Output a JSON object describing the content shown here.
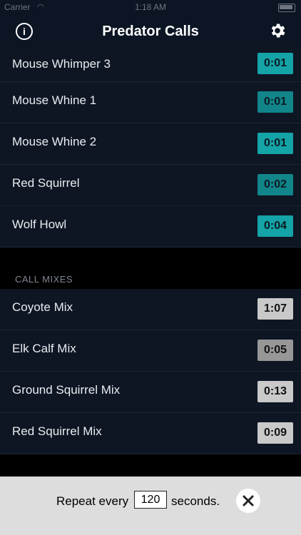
{
  "status": {
    "carrier": "Carrier",
    "time": "1:18 AM"
  },
  "nav": {
    "title": "Predator Calls"
  },
  "calls": [
    {
      "name": "Mouse Whimper 3",
      "duration": "0:01"
    },
    {
      "name": "Mouse Whine 1",
      "duration": "0:01"
    },
    {
      "name": "Mouse Whine 2",
      "duration": "0:01"
    },
    {
      "name": "Red Squirrel",
      "duration": "0:02"
    },
    {
      "name": "Wolf Howl",
      "duration": "0:04"
    }
  ],
  "call_mixes": {
    "header": "CALL MIXES",
    "items": [
      {
        "name": "Coyote Mix",
        "duration": "1:07"
      },
      {
        "name": "Elk Calf Mix",
        "duration": "0:05"
      },
      {
        "name": "Ground Squirrel Mix",
        "duration": "0:13"
      },
      {
        "name": "Red Squirrel Mix",
        "duration": "0:09"
      }
    ]
  },
  "repeat": {
    "prefix": "Repeat every",
    "value": "120",
    "suffix": "seconds."
  },
  "colors": {
    "navbar": "#0b1523",
    "row": "#0e1624",
    "teal": "#14a3a7",
    "gray": "#c9c9c9"
  }
}
